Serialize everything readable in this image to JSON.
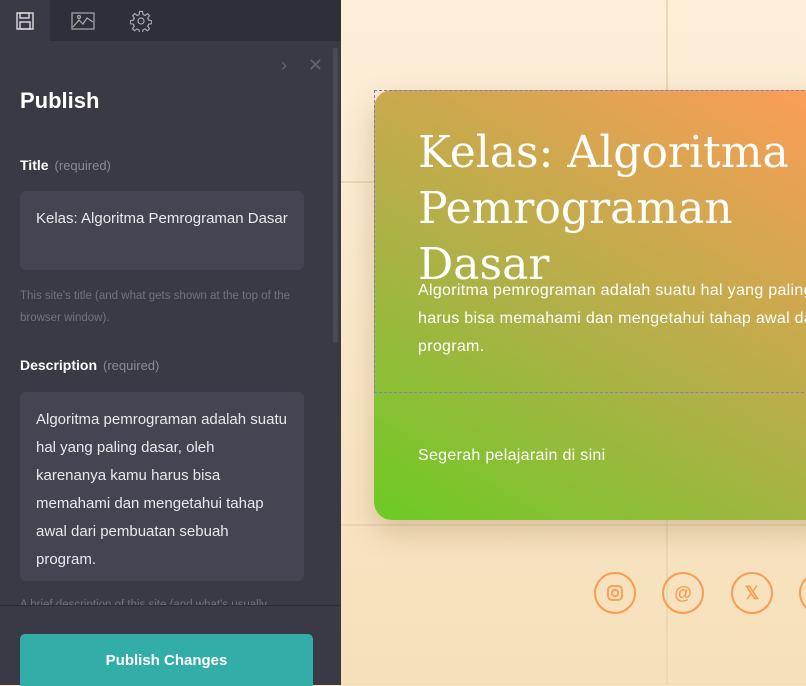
{
  "panel": {
    "tabs": [
      {
        "icon": "save-icon"
      },
      {
        "icon": "image-icon"
      },
      {
        "icon": "gear-icon"
      }
    ],
    "title": "Publish",
    "title_label": "Title",
    "required": "(required)",
    "title_value": "Kelas: Algoritma Pemrograman Dasar",
    "title_help": "This site's title (and what gets shown at the top of the browser window).",
    "description_label": "Description",
    "description_value": "Algoritma pemrograman adalah suatu hal yang paling dasar, oleh karenanya kamu harus bisa memahami dan mengetahui tahap awal dari pembuatan sebuah program.",
    "description_help": "A brief description of this site (and what's usually",
    "publish_button": "Publish Changes"
  },
  "preview": {
    "heading": "Kelas: Algoritma Pemrograman Dasar",
    "text_line1": "Algoritma pemrograman adalah suatu hal yang paling dasar, oleh karenanya kamu",
    "text_line2": "harus bisa memahami dan mengetahui tahap awal dari pembuatan sebuah",
    "text_line3": "program.",
    "link": "Segerah pelajarain di sini",
    "social": [
      "instagram-icon",
      "threads-icon",
      "x-icon"
    ],
    "colors": {
      "accent": "#fb9a50",
      "button": "#32ada8"
    }
  }
}
